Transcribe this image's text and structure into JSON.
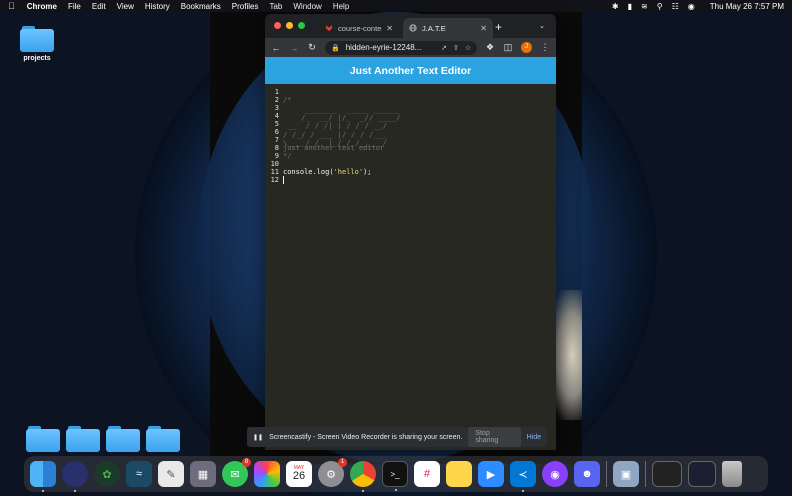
{
  "menubar": {
    "app": "Chrome",
    "items": [
      "File",
      "Edit",
      "View",
      "History",
      "Bookmarks",
      "Profiles",
      "Tab",
      "Window",
      "Help"
    ],
    "clock": "Thu May 26  7:57 PM"
  },
  "desktop": {
    "folder_label": "projects"
  },
  "browser": {
    "tabs": [
      {
        "title": "course-content",
        "active": false
      },
      {
        "title": "J.A.T.E",
        "active": true
      }
    ],
    "url": "hidden-eyrie-12248...",
    "profile_initial": "J"
  },
  "app": {
    "title": "Just Another Text Editor",
    "line_numbers": [
      "1",
      "2",
      "3",
      "4",
      "5",
      "6",
      "7",
      "8",
      "9",
      "10",
      "11",
      "12"
    ],
    "code": {
      "l2": "/*",
      "l8": "just another text editor",
      "l9": "*/",
      "l11_prefix": "console.log(",
      "l11_string": "'hello'",
      "l11_suffix": ");"
    },
    "ascii_art": "     _______  _____ ______\n    /_  __/ |/_  _// ____/\n __  / / /| | / / / __/   \n/ /_/ / ___ |/ / / /___   \n\\____/_/  |_/_/ /_____/   "
  },
  "share_bar": {
    "message": "Screencastify - Screen Video Recorder is sharing your screen.",
    "stop_label": "Stop sharing",
    "hide_label": "Hide"
  },
  "dock": {
    "calendar_month": "MAY",
    "calendar_day": "26",
    "badges": {
      "messages": "8",
      "settings": "1"
    }
  }
}
